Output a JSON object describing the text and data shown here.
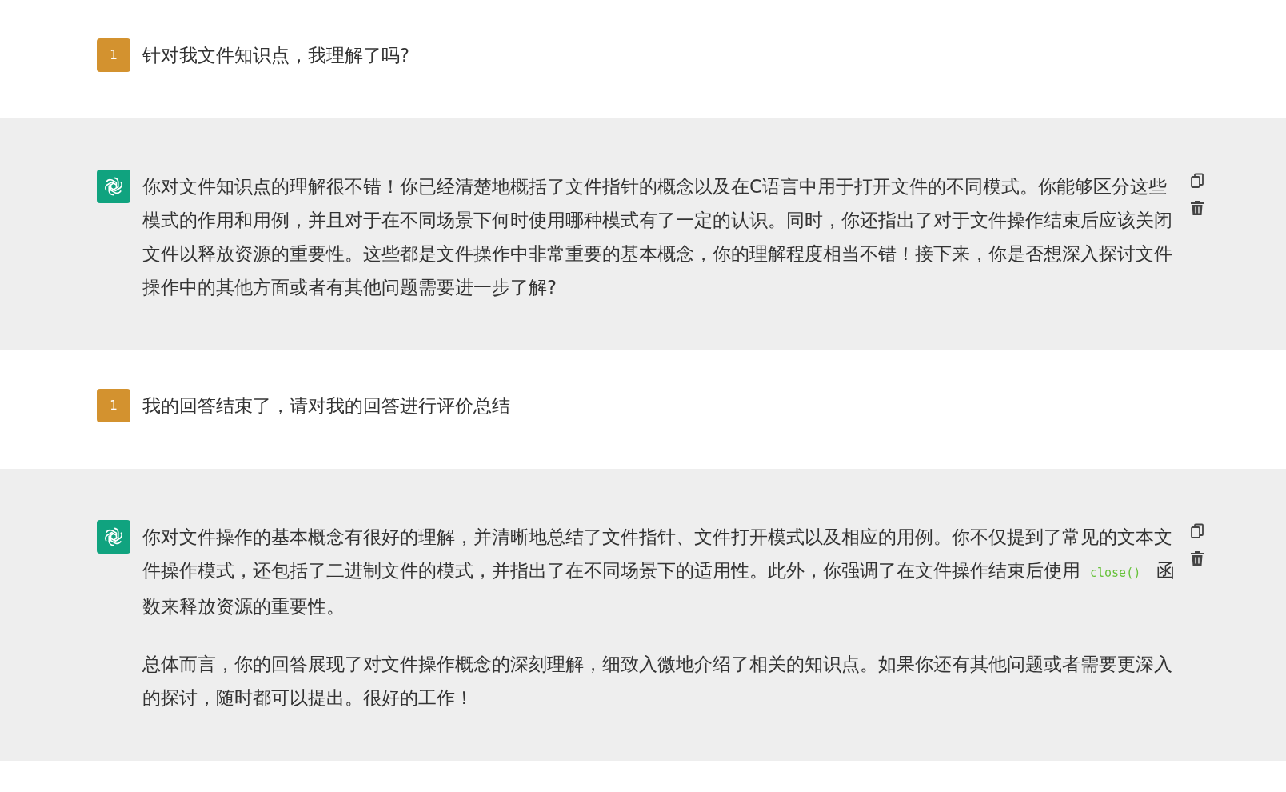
{
  "messages": [
    {
      "kind": "user",
      "avatar": "1",
      "paragraphs": [
        [
          {
            "kind": "text",
            "text": "针对我文件知识点，我理解了吗?"
          }
        ]
      ]
    },
    {
      "kind": "assistant",
      "paragraphs": [
        [
          {
            "kind": "text",
            "text": "你对文件知识点的理解很不错！你已经清楚地概括了文件指针的概念以及在C语言中用于打开文件的不同模式。你能够区分这些模式的作用和用例，并且对于在不同场景下何时使用哪种模式有了一定的认识。同时，你还指出了对于文件操作结束后应该关闭文件以释放资源的重要性。这些都是文件操作中非常重要的基本概念，你的理解程度相当不错！接下来，你是否想深入探讨文件操作中的其他方面或者有其他问题需要进一步了解?"
          }
        ]
      ]
    },
    {
      "kind": "user",
      "avatar": "1",
      "paragraphs": [
        [
          {
            "kind": "text",
            "text": "我的回答结束了，请对我的回答进行评价总结"
          }
        ]
      ]
    },
    {
      "kind": "assistant",
      "paragraphs": [
        [
          {
            "kind": "text",
            "text": "你对文件操作的基本概念有很好的理解，并清晰地总结了文件指针、文件打开模式以及相应的用例。你不仅提到了常见的文本文件操作模式，还包括了二进制文件的模式，并指出了在不同场景下的适用性。此外，你强调了在文件操作结束后使用"
          },
          {
            "kind": "code",
            "text": "close()"
          },
          {
            "kind": "text",
            "text": "函数来释放资源的重要性。"
          }
        ],
        [
          {
            "kind": "text",
            "text": "总体而言，你的回答展现了对文件操作概念的深刻理解，细致入微地介绍了相关的知识点。如果你还有其他问题或者需要更深入的探讨，随时都可以提出。很好的工作！"
          }
        ]
      ]
    }
  ]
}
